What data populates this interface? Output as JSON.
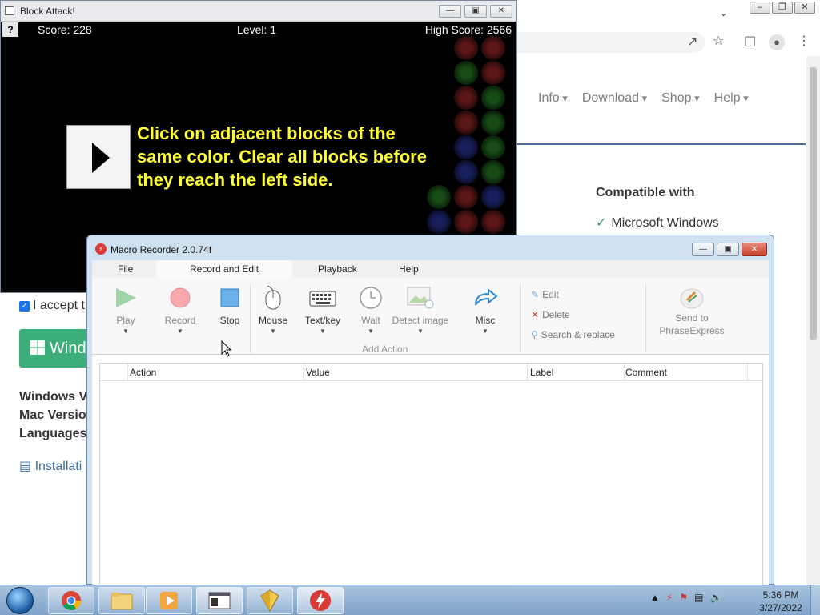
{
  "browser": {
    "nav": [
      "Info",
      "Download",
      "Shop",
      "Help"
    ],
    "compat_title": "Compatible with",
    "compat_item": "Microsoft Windows",
    "accept_text": "I accept t",
    "download_btn": "Wind",
    "info_lines": [
      "Windows V",
      "Mac Versio",
      "Languages"
    ],
    "install_link": "Installati"
  },
  "game": {
    "title": "Block Attack!",
    "help": "?",
    "score": "Score: 228",
    "level": "Level: 1",
    "high_score": "High Score: 2566",
    "instructions": "Click on adjacent blocks of the same color. Clear all blocks before they reach the left side.",
    "block_colors": [
      "#2a8a2a",
      "#a52828",
      "#2a3aa8"
    ]
  },
  "macro": {
    "title": "Macro Recorder 2.0.74f",
    "menu": [
      "File",
      "Record and Edit",
      "Playback",
      "Help"
    ],
    "ribbon": {
      "play": "Play",
      "record": "Record",
      "stop": "Stop",
      "mouse": "Mouse",
      "textkey": "Text/key",
      "wait": "Wait",
      "detect": "Detect image",
      "misc": "Misc",
      "group_label": "Add Action",
      "edit": "Edit",
      "delete": "Delete",
      "search": "Search & replace",
      "send_line1": "Send to",
      "send_line2": "PhraseExpress"
    },
    "columns": [
      "Action",
      "Value",
      "Label",
      "Comment"
    ]
  },
  "taskbar": {
    "time": "5:36 PM",
    "date": "3/27/2022"
  }
}
